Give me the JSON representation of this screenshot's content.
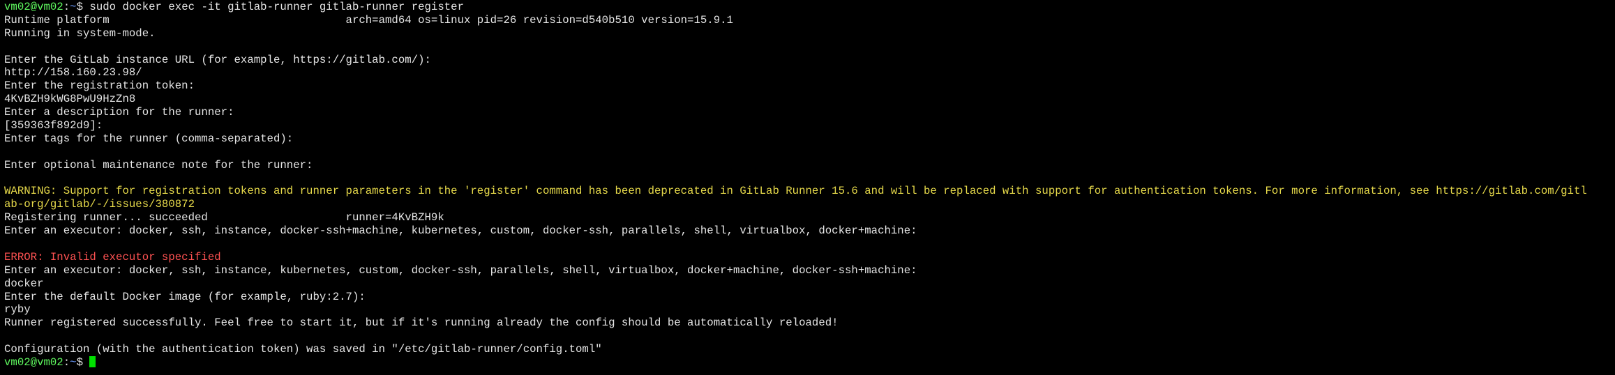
{
  "terminal": {
    "colors": {
      "background": "#000000",
      "text": "#e5e5e5",
      "prompt_user": "#5ff95f",
      "prompt_path": "#6b9bff",
      "warning": "#e6d94a",
      "error": "#ff5252",
      "cursor": "#00e000"
    },
    "prompt": {
      "user_host": "vm02@vm02",
      "sep": ":",
      "path": "~",
      "symbol": "$ "
    },
    "command": "sudo docker exec -it gitlab-runner gitlab-runner register",
    "lines": {
      "l1": "Runtime platform                                    arch=amd64 os=linux pid=26 revision=d540b510 version=15.9.1",
      "l2": "Running in system-mode.",
      "l3": "",
      "l4": "Enter the GitLab instance URL (for example, https://gitlab.com/):",
      "l5": "http://158.160.23.98/",
      "l6": "Enter the registration token:",
      "l7": "4KvBZH9kWG8PwU9HzZn8",
      "l8": "Enter a description for the runner:",
      "l9": "[359363f892d9]:",
      "l10": "Enter tags for the runner (comma-separated):",
      "l11": "",
      "l12": "Enter optional maintenance note for the runner:",
      "l13": "",
      "l14": "WARNING: Support for registration tokens and runner parameters in the 'register' command has been deprecated in GitLab Runner 15.6 and will be replaced with support for authentication tokens. For more information, see https://gitlab.com/gitl",
      "l15": "ab-org/gitlab/-/issues/380872",
      "l16": "Registering runner... succeeded                     runner=4KvBZH9k",
      "l17": "Enter an executor: docker, ssh, instance, docker-ssh+machine, kubernetes, custom, docker-ssh, parallels, shell, virtualbox, docker+machine:",
      "l18": "",
      "l19": "ERROR: Invalid executor specified",
      "l20": "Enter an executor: docker, ssh, instance, kubernetes, custom, docker-ssh, parallels, shell, virtualbox, docker+machine, docker-ssh+machine:",
      "l21": "docker",
      "l22": "Enter the default Docker image (for example, ruby:2.7):",
      "l23": "ryby",
      "l24": "Runner registered successfully. Feel free to start it, but if it's running already the config should be automatically reloaded!",
      "l25": "",
      "l26": "Configuration (with the authentication token) was saved in \"/etc/gitlab-runner/config.toml\""
    }
  }
}
